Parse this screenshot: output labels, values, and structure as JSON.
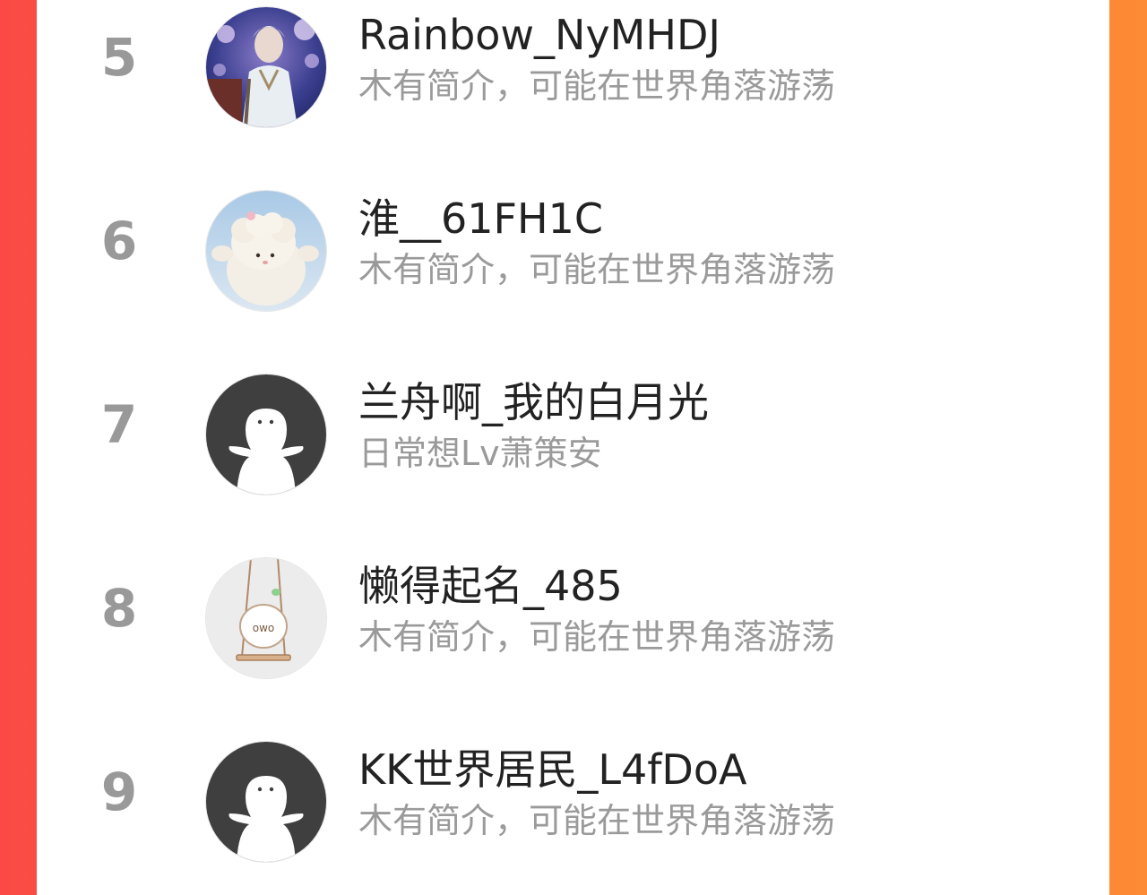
{
  "ranking": {
    "items": [
      {
        "rank": "5",
        "name": "Rainbow_NyMHDJ",
        "bio": "木有简介，可能在世界角落游荡",
        "avatar_icon": "anime-character-avatar-icon"
      },
      {
        "rank": "6",
        "name": "淮__61FH1C",
        "bio": "木有简介，可能在世界角落游荡",
        "avatar_icon": "plush-lamb-avatar-icon"
      },
      {
        "rank": "7",
        "name": "兰舟啊_我的白月光",
        "bio": "日常想Lv萧策安",
        "avatar_icon": "default-avatar-icon"
      },
      {
        "rank": "8",
        "name": "懒得起名_485",
        "bio": "木有简介，可能在世界角落游荡",
        "avatar_icon": "swing-doodle-avatar-icon"
      },
      {
        "rank": "9",
        "name": "KK世界居民_L4fDoA",
        "bio": "木有简介，可能在世界角落游荡",
        "avatar_icon": "default-avatar-icon"
      }
    ]
  },
  "colors": {
    "background_left": "#fb4a45",
    "background_right": "#fd8a35",
    "rank_text": "#999999",
    "name_text": "#222222",
    "bio_text": "#9a9a9a"
  }
}
